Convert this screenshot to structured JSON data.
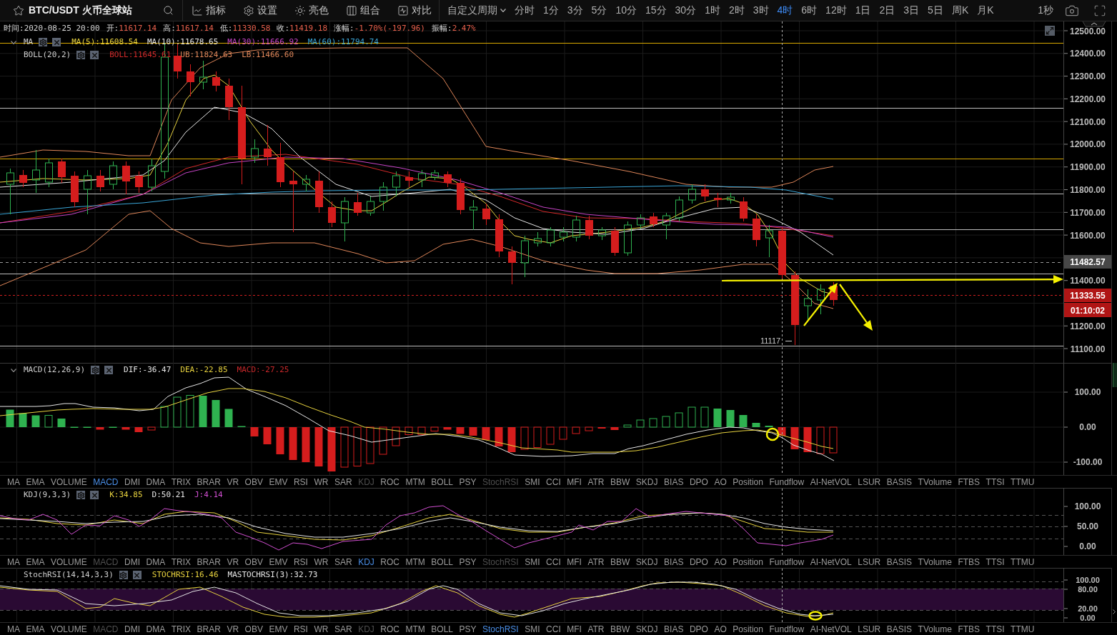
{
  "toolbar": {
    "symbol": "BTC/USDT 火币全球站",
    "tools": [
      {
        "label": "指标"
      },
      {
        "label": "设置"
      },
      {
        "label": "亮色"
      },
      {
        "label": "组合"
      },
      {
        "label": "对比"
      }
    ],
    "period_menu": "自定义周期",
    "periods": [
      {
        "label": "分时",
        "selected": false
      },
      {
        "label": "1分",
        "selected": false
      },
      {
        "label": "3分",
        "selected": false
      },
      {
        "label": "5分",
        "selected": false
      },
      {
        "label": "10分",
        "selected": false
      },
      {
        "label": "15分",
        "selected": false
      },
      {
        "label": "30分",
        "selected": false
      },
      {
        "label": "1时",
        "selected": false
      },
      {
        "label": "2时",
        "selected": false
      },
      {
        "label": "3时",
        "selected": false
      },
      {
        "label": "4时",
        "selected": true
      },
      {
        "label": "6时",
        "selected": false
      },
      {
        "label": "12时",
        "selected": false
      },
      {
        "label": "1日",
        "selected": false
      },
      {
        "label": "2日",
        "selected": false
      },
      {
        "label": "3日",
        "selected": false
      },
      {
        "label": "5日",
        "selected": false
      },
      {
        "label": "周K",
        "selected": false
      },
      {
        "label": "月K",
        "selected": false
      }
    ],
    "refresh": "1秒"
  },
  "quote_bar": [
    {
      "kind": "time",
      "label": "时间:",
      "value": "2020-08-25 20:00"
    },
    {
      "kind": "quote",
      "label": "开:",
      "value": "11617.14"
    },
    {
      "kind": "quote",
      "label": "高:",
      "value": "11617.14"
    },
    {
      "kind": "quote",
      "label": "低:",
      "value": "11330.58"
    },
    {
      "kind": "quote",
      "label": "收:",
      "value": "11419.18"
    },
    {
      "kind": "quote",
      "label": "涨幅:",
      "value": "-1.70%(-197.96)"
    },
    {
      "kind": "quote",
      "label": "振幅:",
      "value": "2.47%"
    }
  ],
  "main_chart": {
    "legends": [
      {
        "name": "MA",
        "collapsible": true,
        "values": [
          {
            "text": "MA(5):11608.54",
            "color": "#e8d33f"
          },
          {
            "text": "MA(10):11678.65",
            "color": "#e6e6e6"
          },
          {
            "text": "MA(30):11666.92",
            "color": "#c845c8"
          },
          {
            "text": "MA(60):11794.74",
            "color": "#3aa6d8"
          }
        ]
      },
      {
        "name": "BOLL(20,2)",
        "collapsible": false,
        "values": [
          {
            "text": "BOLL:11645.61",
            "color": "#d42a2a"
          },
          {
            "text": "UB:11824.63",
            "color": "#e0875a"
          },
          {
            "text": "LB:11466.60",
            "color": "#e0875a"
          }
        ]
      }
    ],
    "low_marker": "11117",
    "axis": [
      "12500.00",
      "12400.00",
      "12300.00",
      "12200.00",
      "12100.00",
      "12000.00",
      "11900.00",
      "11800.00",
      "11700.00",
      "11600.00",
      "11400.00",
      "11200.00",
      "11100.00"
    ],
    "price_tags": [
      {
        "kind": "last",
        "text": "11482.57"
      },
      {
        "kind": "current",
        "text": "11333.55"
      },
      {
        "kind": "countdown",
        "text": "01:10:02"
      }
    ]
  },
  "panels": [
    {
      "kind": "macd",
      "name": "MACD(12,26,9)",
      "collapsible": true,
      "values": [
        {
          "text": "DIF:-36.47",
          "color": "#e6e6e6"
        },
        {
          "text": "DEA:-22.85",
          "color": "#e8d33f"
        },
        {
          "text": "MACD:-27.25",
          "color": "#c8282a"
        }
      ],
      "axis": [
        "100.00",
        "0.00",
        "-100.00"
      ],
      "tabs": [
        {
          "label": "MA",
          "selected": false,
          "disabled": false
        },
        {
          "label": "EMA",
          "selected": false,
          "disabled": false
        },
        {
          "label": "VOLUME",
          "selected": false,
          "disabled": false
        },
        {
          "label": "MACD",
          "selected": true,
          "disabled": false
        },
        {
          "label": "DMI",
          "selected": false,
          "disabled": false
        },
        {
          "label": "DMA",
          "selected": false,
          "disabled": false
        },
        {
          "label": "TRIX",
          "selected": false,
          "disabled": false
        },
        {
          "label": "BRAR",
          "selected": false,
          "disabled": false
        },
        {
          "label": "VR",
          "selected": false,
          "disabled": false
        },
        {
          "label": "OBV",
          "selected": false,
          "disabled": false
        },
        {
          "label": "EMV",
          "selected": false,
          "disabled": false
        },
        {
          "label": "RSI",
          "selected": false,
          "disabled": false
        },
        {
          "label": "WR",
          "selected": false,
          "disabled": false
        },
        {
          "label": "SAR",
          "selected": false,
          "disabled": false
        },
        {
          "label": "KDJ",
          "selected": false,
          "disabled": true
        },
        {
          "label": "ROC",
          "selected": false,
          "disabled": false
        },
        {
          "label": "MTM",
          "selected": false,
          "disabled": false
        },
        {
          "label": "BOLL",
          "selected": false,
          "disabled": false
        },
        {
          "label": "PSY",
          "selected": false,
          "disabled": false
        },
        {
          "label": "StochRSI",
          "selected": false,
          "disabled": true
        },
        {
          "label": "SMI",
          "selected": false,
          "disabled": false
        },
        {
          "label": "CCI",
          "selected": false,
          "disabled": false
        },
        {
          "label": "MFI",
          "selected": false,
          "disabled": false
        },
        {
          "label": "ATR",
          "selected": false,
          "disabled": false
        },
        {
          "label": "BBW",
          "selected": false,
          "disabled": false
        },
        {
          "label": "SKDJ",
          "selected": false,
          "disabled": false
        },
        {
          "label": "BIAS",
          "selected": false,
          "disabled": false
        },
        {
          "label": "DPO",
          "selected": false,
          "disabled": false
        },
        {
          "label": "AO",
          "selected": false,
          "disabled": false
        },
        {
          "label": "Position",
          "selected": false,
          "disabled": false
        },
        {
          "label": "Fundflow",
          "selected": false,
          "disabled": false
        },
        {
          "label": "AI-NetVOL",
          "selected": false,
          "disabled": false
        },
        {
          "label": "LSUR",
          "selected": false,
          "disabled": false
        },
        {
          "label": "BASIS",
          "selected": false,
          "disabled": false
        },
        {
          "label": "TVolume",
          "selected": false,
          "disabled": false
        },
        {
          "label": "FTBS",
          "selected": false,
          "disabled": false
        },
        {
          "label": "TTSI",
          "selected": false,
          "disabled": false
        },
        {
          "label": "TTMU",
          "selected": false,
          "disabled": false
        }
      ]
    },
    {
      "kind": "kdj",
      "name": "KDJ(9,3,3)",
      "collapsible": false,
      "values": [
        {
          "text": "K:34.85",
          "color": "#e8d33f"
        },
        {
          "text": "D:50.21",
          "color": "#e6e6e6"
        },
        {
          "text": "J:4.14",
          "color": "#d24fd2"
        }
      ],
      "axis": [
        "100.00",
        "50.00",
        "0.00"
      ],
      "tabs": [
        {
          "label": "MA",
          "selected": false,
          "disabled": false
        },
        {
          "label": "EMA",
          "selected": false,
          "disabled": false
        },
        {
          "label": "VOLUME",
          "selected": false,
          "disabled": false
        },
        {
          "label": "MACD",
          "selected": false,
          "disabled": true
        },
        {
          "label": "DMI",
          "selected": false,
          "disabled": false
        },
        {
          "label": "DMA",
          "selected": false,
          "disabled": false
        },
        {
          "label": "TRIX",
          "selected": false,
          "disabled": false
        },
        {
          "label": "BRAR",
          "selected": false,
          "disabled": false
        },
        {
          "label": "VR",
          "selected": false,
          "disabled": false
        },
        {
          "label": "OBV",
          "selected": false,
          "disabled": false
        },
        {
          "label": "EMV",
          "selected": false,
          "disabled": false
        },
        {
          "label": "RSI",
          "selected": false,
          "disabled": false
        },
        {
          "label": "WR",
          "selected": false,
          "disabled": false
        },
        {
          "label": "SAR",
          "selected": false,
          "disabled": false
        },
        {
          "label": "KDJ",
          "selected": true,
          "disabled": false
        },
        {
          "label": "ROC",
          "selected": false,
          "disabled": false
        },
        {
          "label": "MTM",
          "selected": false,
          "disabled": false
        },
        {
          "label": "BOLL",
          "selected": false,
          "disabled": false
        },
        {
          "label": "PSY",
          "selected": false,
          "disabled": false
        },
        {
          "label": "StochRSI",
          "selected": false,
          "disabled": true
        },
        {
          "label": "SMI",
          "selected": false,
          "disabled": false
        },
        {
          "label": "CCI",
          "selected": false,
          "disabled": false
        },
        {
          "label": "MFI",
          "selected": false,
          "disabled": false
        },
        {
          "label": "ATR",
          "selected": false,
          "disabled": false
        },
        {
          "label": "BBW",
          "selected": false,
          "disabled": false
        },
        {
          "label": "SKDJ",
          "selected": false,
          "disabled": false
        },
        {
          "label": "BIAS",
          "selected": false,
          "disabled": false
        },
        {
          "label": "DPO",
          "selected": false,
          "disabled": false
        },
        {
          "label": "AO",
          "selected": false,
          "disabled": false
        },
        {
          "label": "Position",
          "selected": false,
          "disabled": false
        },
        {
          "label": "Fundflow",
          "selected": false,
          "disabled": false
        },
        {
          "label": "AI-NetVOL",
          "selected": false,
          "disabled": false
        },
        {
          "label": "LSUR",
          "selected": false,
          "disabled": false
        },
        {
          "label": "BASIS",
          "selected": false,
          "disabled": false
        },
        {
          "label": "TVolume",
          "selected": false,
          "disabled": false
        },
        {
          "label": "FTBS",
          "selected": false,
          "disabled": false
        },
        {
          "label": "TTSI",
          "selected": false,
          "disabled": false
        },
        {
          "label": "TTMU",
          "selected": false,
          "disabled": false
        }
      ]
    },
    {
      "kind": "stochrsi",
      "name": "StochRSI(14,14,3,3)",
      "collapsible": false,
      "values": [
        {
          "text": "STOCHRSI:16.46",
          "color": "#e8d33f"
        },
        {
          "text": "MASTOCHRSI(3):32.73",
          "color": "#e6e6e6"
        }
      ],
      "axis": [
        "100.00",
        "80.00",
        "20.00",
        "0.00"
      ],
      "tabs": [
        {
          "label": "MA",
          "selected": false,
          "disabled": false
        },
        {
          "label": "EMA",
          "selected": false,
          "disabled": false
        },
        {
          "label": "VOLUME",
          "selected": false,
          "disabled": false
        },
        {
          "label": "MACD",
          "selected": false,
          "disabled": true
        },
        {
          "label": "DMI",
          "selected": false,
          "disabled": false
        },
        {
          "label": "DMA",
          "selected": false,
          "disabled": false
        },
        {
          "label": "TRIX",
          "selected": false,
          "disabled": false
        },
        {
          "label": "BRAR",
          "selected": false,
          "disabled": false
        },
        {
          "label": "VR",
          "selected": false,
          "disabled": false
        },
        {
          "label": "OBV",
          "selected": false,
          "disabled": false
        },
        {
          "label": "EMV",
          "selected": false,
          "disabled": false
        },
        {
          "label": "RSI",
          "selected": false,
          "disabled": false
        },
        {
          "label": "WR",
          "selected": false,
          "disabled": false
        },
        {
          "label": "SAR",
          "selected": false,
          "disabled": false
        },
        {
          "label": "KDJ",
          "selected": false,
          "disabled": true
        },
        {
          "label": "ROC",
          "selected": false,
          "disabled": false
        },
        {
          "label": "MTM",
          "selected": false,
          "disabled": false
        },
        {
          "label": "BOLL",
          "selected": false,
          "disabled": false
        },
        {
          "label": "PSY",
          "selected": false,
          "disabled": false
        },
        {
          "label": "StochRSI",
          "selected": true,
          "disabled": false
        },
        {
          "label": "SMI",
          "selected": false,
          "disabled": false
        },
        {
          "label": "CCI",
          "selected": false,
          "disabled": false
        },
        {
          "label": "MFI",
          "selected": false,
          "disabled": false
        },
        {
          "label": "ATR",
          "selected": false,
          "disabled": false
        },
        {
          "label": "BBW",
          "selected": false,
          "disabled": false
        },
        {
          "label": "SKDJ",
          "selected": false,
          "disabled": false
        },
        {
          "label": "BIAS",
          "selected": false,
          "disabled": false
        },
        {
          "label": "DPO",
          "selected": false,
          "disabled": false
        },
        {
          "label": "AO",
          "selected": false,
          "disabled": false
        },
        {
          "label": "Position",
          "selected": false,
          "disabled": false
        },
        {
          "label": "Fundflow",
          "selected": false,
          "disabled": false
        },
        {
          "label": "AI-NetVOL",
          "selected": false,
          "disabled": false
        },
        {
          "label": "LSUR",
          "selected": false,
          "disabled": false
        },
        {
          "label": "BASIS",
          "selected": false,
          "disabled": false
        },
        {
          "label": "TVolume",
          "selected": false,
          "disabled": false
        },
        {
          "label": "FTBS",
          "selected": false,
          "disabled": false
        },
        {
          "label": "TTSI",
          "selected": false,
          "disabled": false
        },
        {
          "label": "TTMU",
          "selected": false,
          "disabled": false
        }
      ]
    }
  ]
}
